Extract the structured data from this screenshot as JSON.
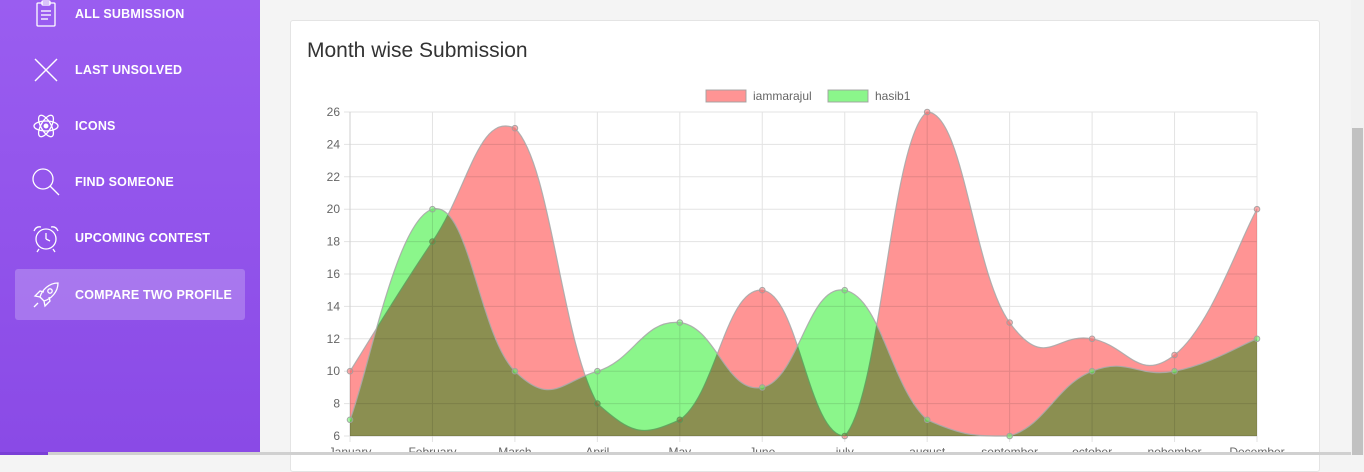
{
  "sidebar": {
    "items": [
      {
        "label": "ALL SUBMISSION",
        "icon": "clipboard-icon",
        "active": false
      },
      {
        "label": "LAST UNSOLVED",
        "icon": "close-icon",
        "active": false
      },
      {
        "label": "ICONS",
        "icon": "atom-icon",
        "active": false
      },
      {
        "label": "FIND SOMEONE",
        "icon": "search-icon",
        "active": false
      },
      {
        "label": "UPCOMING CONTEST",
        "icon": "alarm-clock-icon",
        "active": false
      },
      {
        "label": "COMPARE TWO PROFILE",
        "icon": "rocket-icon",
        "active": true
      }
    ]
  },
  "card": {
    "title": "Month wise Submission"
  },
  "chart_data": {
    "type": "area",
    "categories": [
      "January",
      "February",
      "March",
      "April",
      "May",
      "June",
      "july",
      "august",
      "september",
      "october",
      "nobember",
      "December"
    ],
    "series": [
      {
        "name": "iammarajul",
        "values": [
          10,
          18,
          25,
          8,
          7,
          15,
          6,
          26,
          13,
          12,
          11,
          20
        ],
        "color": "#ff6b6b"
      },
      {
        "name": "hasib1",
        "values": [
          7,
          20,
          10,
          10,
          13,
          9,
          15,
          7,
          6,
          10,
          10,
          12
        ],
        "color": "#5ef25e"
      }
    ],
    "ylim": [
      6,
      26
    ],
    "yticks": [
      6,
      8,
      10,
      12,
      14,
      16,
      18,
      20,
      22,
      24,
      26
    ],
    "grid": true,
    "legend": "top-center"
  }
}
